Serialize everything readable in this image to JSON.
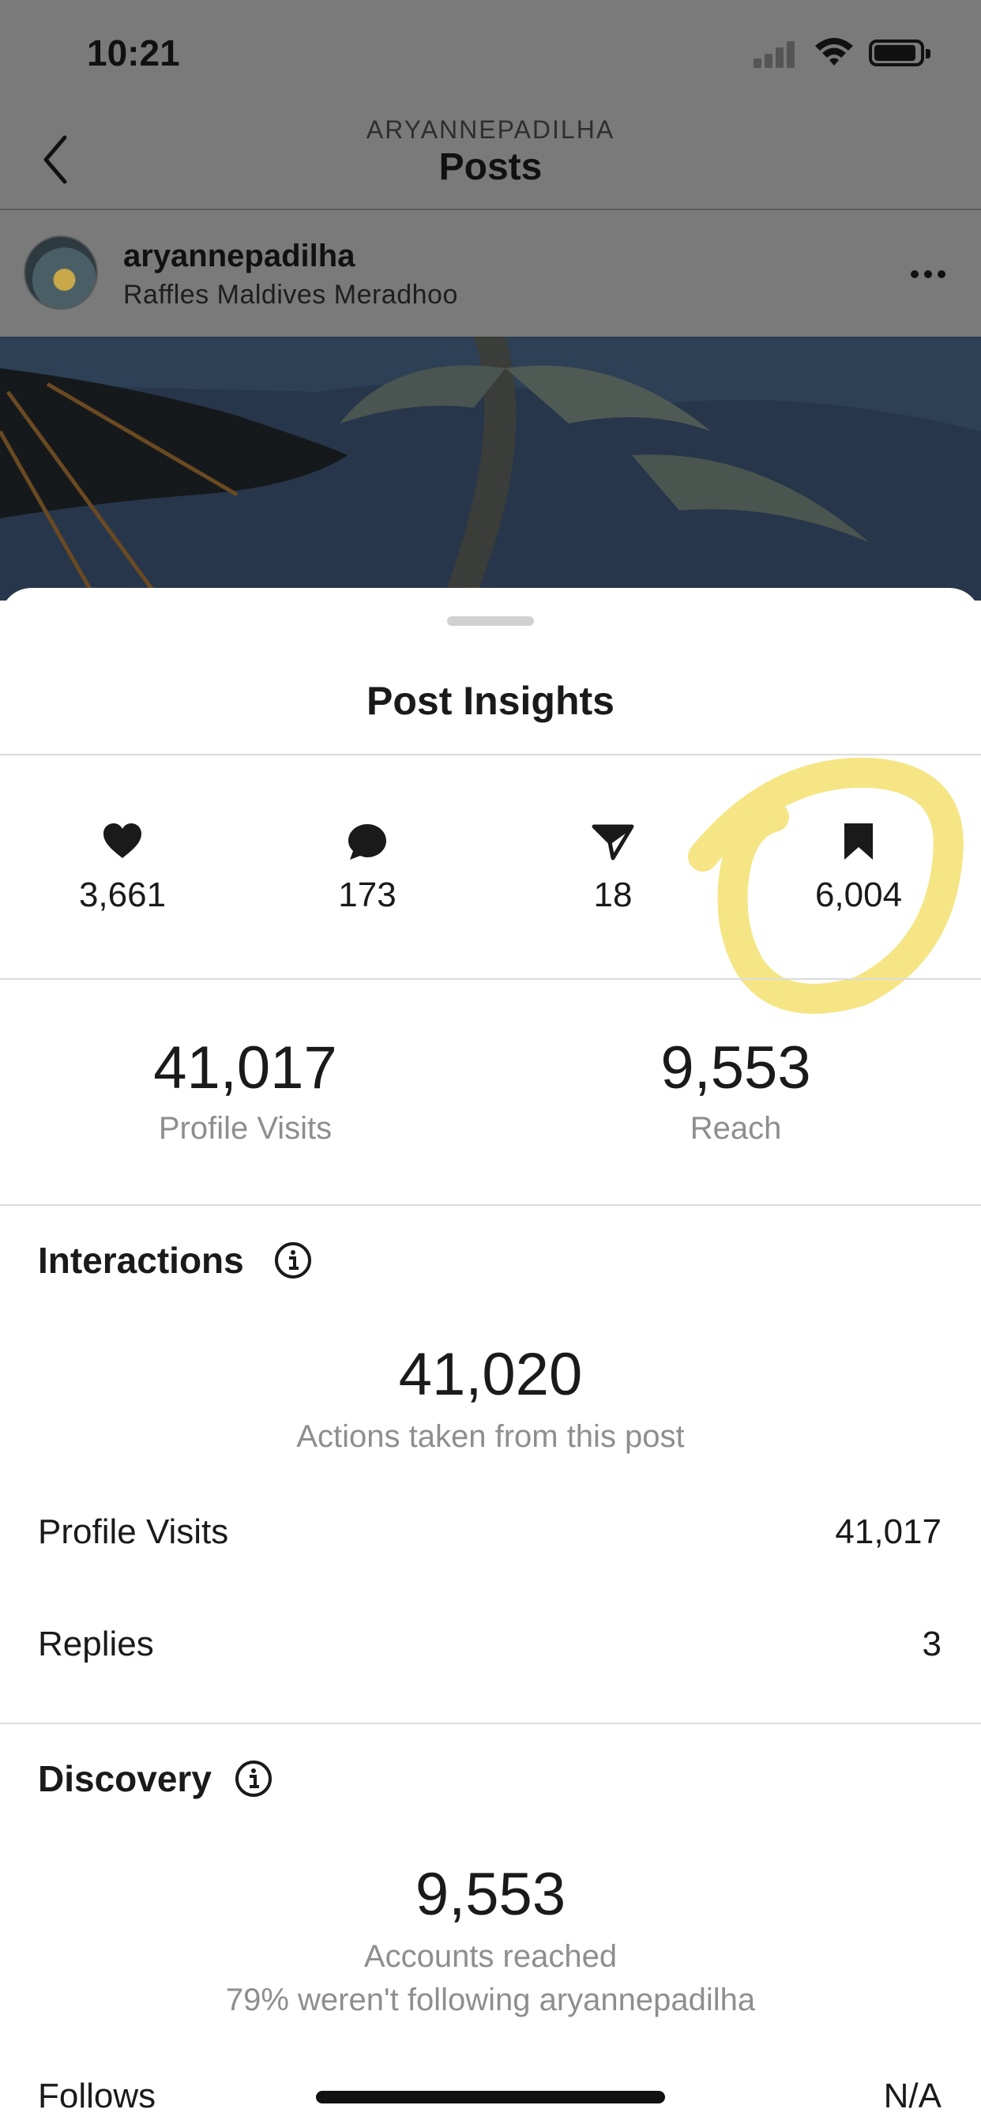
{
  "status_bar": {
    "time": "10:21",
    "icons": [
      "cellular-signal-icon",
      "wifi-icon",
      "battery-icon"
    ]
  },
  "header": {
    "account": "ARYANNEPADILHA",
    "title": "Posts",
    "back_icon": "chevron-left-icon"
  },
  "post": {
    "username": "aryannepadilha",
    "location": "Raffles Maldives Meradhoo",
    "more_icon": "ellipsis-icon"
  },
  "insights": {
    "title": "Post Insights",
    "likes": "3,661",
    "comments": "173",
    "shares": "18",
    "saves": "6,004",
    "profile_visits": "41,017",
    "profile_visits_label": "Profile Visits",
    "reach": "9,553",
    "reach_label": "Reach"
  },
  "interactions": {
    "heading": "Interactions",
    "total": "41,020",
    "total_label": "Actions taken from this post",
    "rows": [
      {
        "label": "Profile Visits",
        "value": "41,017"
      },
      {
        "label": "Replies",
        "value": "3"
      }
    ]
  },
  "discovery": {
    "heading": "Discovery",
    "total": "9,553",
    "total_label": "Accounts reached",
    "sub_label": "79% weren't following aryannepadilha",
    "rows": [
      {
        "label": "Follows",
        "value": "N/A"
      }
    ]
  },
  "colors": {
    "highlight": "#f5e070",
    "muted_text": "#8e8e8e",
    "dim_overlay": "#7a7a7a"
  }
}
